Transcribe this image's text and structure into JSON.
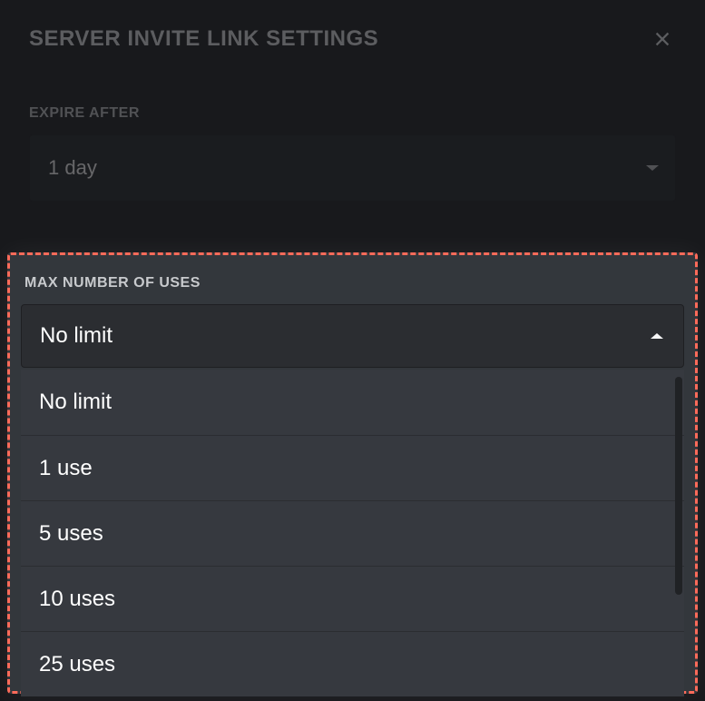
{
  "modal": {
    "title": "Server invite link settings"
  },
  "fields": {
    "expire": {
      "label": "Expire after",
      "value": "1 day"
    },
    "maxUses": {
      "label": "Max number of uses",
      "value": "No limit",
      "options": [
        "No limit",
        "1 use",
        "5 uses",
        "10 uses",
        "25 uses"
      ]
    }
  }
}
